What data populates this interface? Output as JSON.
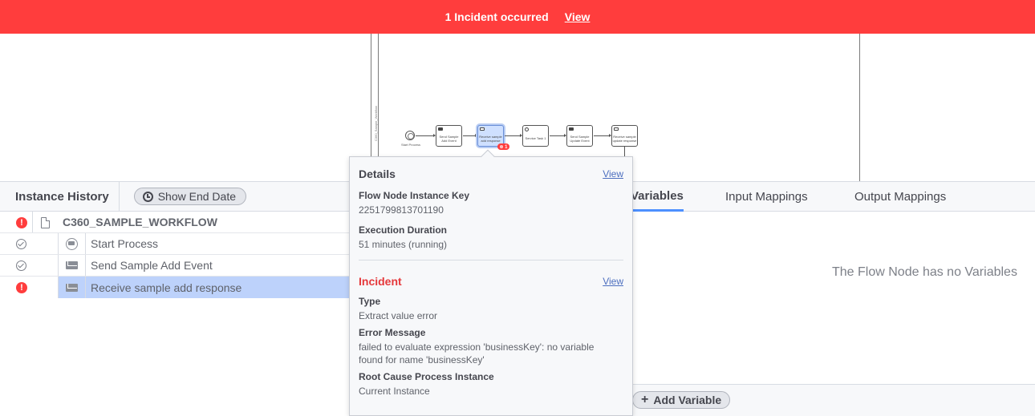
{
  "banner": {
    "message": "1 Incident occurred",
    "view_link": "View",
    "color": "#ff3d3d"
  },
  "diagram": {
    "lane_label": "C360_Sample_Workflow",
    "start_event_label": "Start Process",
    "tasks": [
      "Send Sample Add Event",
      "Receive sample add response",
      "Service Task 1",
      "Send Sample Update Event",
      "Receive sample update response"
    ],
    "incident_badge": "⊗ 1"
  },
  "instance_history": {
    "title": "Instance History",
    "show_end_date": "Show End Date",
    "root": {
      "label": "C360_SAMPLE_WORKFLOW",
      "status": "incident"
    },
    "rows": [
      {
        "label": "Start Process",
        "status": "completed",
        "icon": "start-event-icon"
      },
      {
        "label": "Send Sample Add Event",
        "status": "completed",
        "icon": "envelope-icon"
      },
      {
        "label": "Receive sample add response",
        "status": "incident",
        "icon": "envelope-icon",
        "selected": true
      }
    ]
  },
  "variables_panel": {
    "tabs": [
      "Variables",
      "Input Mappings",
      "Output Mappings"
    ],
    "active_tab": "Variables",
    "empty_message": "The Flow Node has no Variables",
    "add_variable": "Add Variable",
    "add_icon": "+"
  },
  "popover": {
    "details_title": "Details",
    "details_view": "View",
    "instance_key_label": "Flow Node Instance Key",
    "instance_key_value": "2251799813701190",
    "duration_label": "Execution Duration",
    "duration_value": "51 minutes (running)",
    "incident_title": "Incident",
    "incident_view": "View",
    "type_label": "Type",
    "type_value": "Extract value error",
    "error_label": "Error Message",
    "error_value": "failed to evaluate expression 'businessKey': no variable found for name 'businessKey'",
    "root_cause_label": "Root Cause Process Instance",
    "root_cause_value": "Current Instance"
  }
}
